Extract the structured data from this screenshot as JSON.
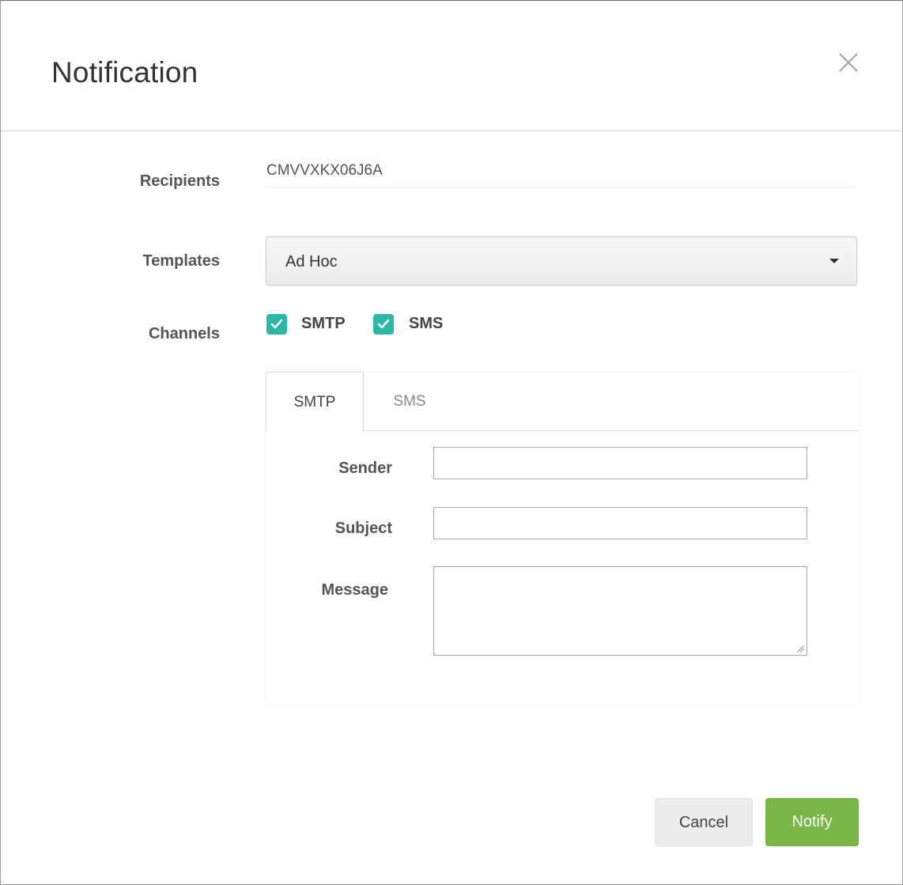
{
  "dialog": {
    "title": "Notification",
    "close_icon": "close-icon"
  },
  "form": {
    "recipients_label": "Recipients",
    "recipients_value": "CMVVXKX06J6A",
    "templates_label": "Templates",
    "templates_selected": "Ad Hoc",
    "channels_label": "Channels",
    "channels": [
      {
        "label": "SMTP",
        "checked": true
      },
      {
        "label": "SMS",
        "checked": true
      }
    ],
    "checkbox_color": "#2bb7a6"
  },
  "tabs": {
    "items": [
      {
        "label": "SMTP",
        "active": true
      },
      {
        "label": "SMS",
        "active": false
      }
    ]
  },
  "smtp": {
    "sender_label": "Sender",
    "sender_value": "",
    "subject_label": "Subject",
    "subject_value": "",
    "message_label": "Message",
    "message_value": ""
  },
  "footer": {
    "cancel_label": "Cancel",
    "notify_label": "Notify",
    "notify_color": "#7ab648"
  }
}
